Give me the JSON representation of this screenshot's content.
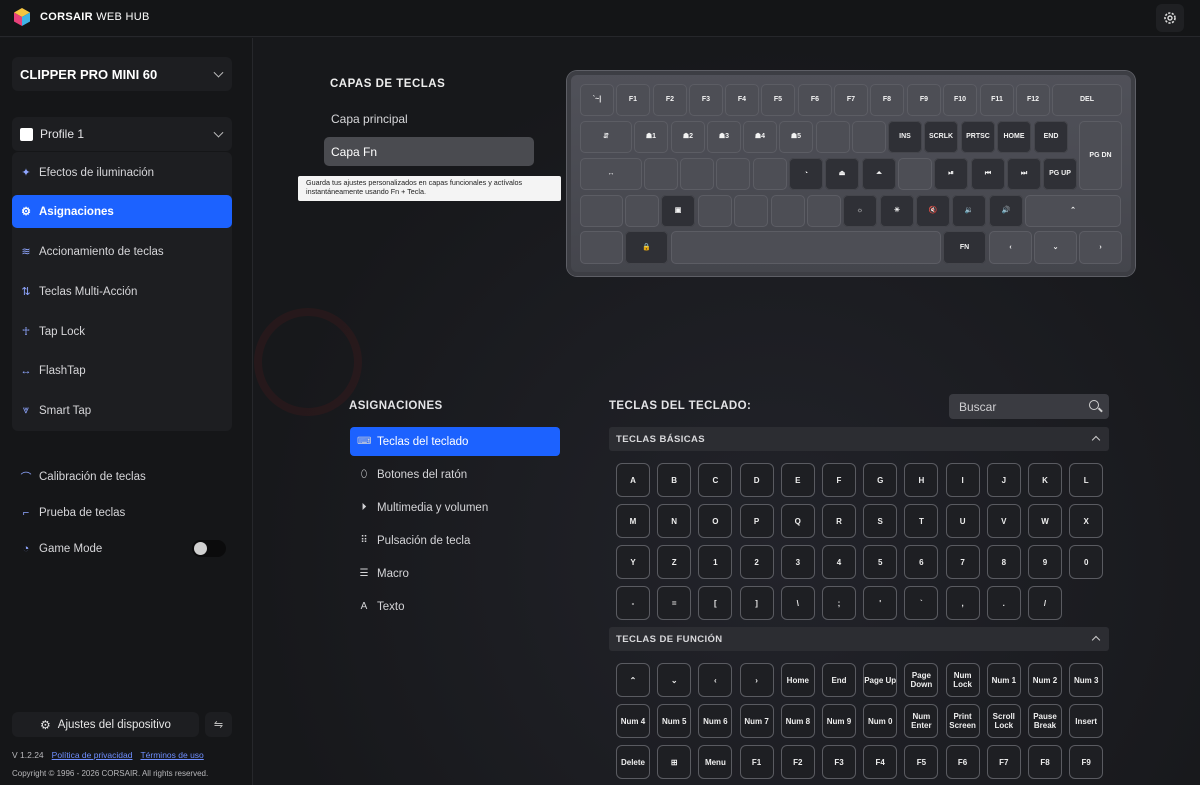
{
  "app": {
    "brand_bold": "CORSAIR",
    "brand_light": "WEB HUB"
  },
  "sidebar": {
    "device": "CLIPPER PRO MINI 60",
    "profile": "Profile 1",
    "nav": [
      {
        "label": "Efectos de iluminación",
        "icon": "sparkle-icon",
        "glyph": "✦"
      },
      {
        "label": "Asignaciones",
        "icon": "assign-icon",
        "glyph": "⚙"
      },
      {
        "label": "Accionamiento de teclas",
        "icon": "layers-icon",
        "glyph": "≋"
      },
      {
        "label": "Teclas Multi-Acción",
        "icon": "updown-arrows-icon",
        "glyph": "⇅"
      },
      {
        "label": "Tap Lock",
        "icon": "person-icon",
        "glyph": "☥"
      },
      {
        "label": "FlashTap",
        "icon": "leftright-arrows-icon",
        "glyph": "↔"
      },
      {
        "label": "Smart Tap",
        "icon": "chevrons-down-icon",
        "glyph": "⩔"
      }
    ],
    "tools": [
      {
        "label": "Calibración de teclas",
        "icon": "calibration-icon",
        "glyph": "⌒"
      },
      {
        "label": "Prueba de teclas",
        "icon": "test-icon",
        "glyph": "⌐"
      },
      {
        "label": "Game Mode",
        "icon": "gauge-icon",
        "glyph": "◔"
      }
    ],
    "game_mode_on": false,
    "settings_label": "Ajustes del dispositivo",
    "version": "V 1.2.24",
    "privacy": "Política de privacidad",
    "terms": "Términos de uso",
    "copyright": "Copyright © 1996 - 2026 CORSAIR. All rights reserved."
  },
  "layers": {
    "title": "CAPAS DE TECLAS",
    "items": [
      "Capa principal",
      "Capa Fn"
    ],
    "active": "Capa Fn",
    "tooltip": "Guarda tus ajustes personalizados en capas funcionales y actívalos instantáneamente usando Fn + Tecla."
  },
  "keyboard": {
    "row1": [
      "`~|",
      "F1",
      "F2",
      "F3",
      "F4",
      "F5",
      "F6",
      "F7",
      "F8",
      "F9",
      "F10",
      "F11",
      "F12",
      "DEL"
    ],
    "row2": [
      "⇵",
      "☗1",
      "☗2",
      "☗3",
      "☗4",
      "☗5",
      "",
      "",
      "INS",
      "SCRLK",
      "PRTSC",
      "HOME",
      "END",
      "PG DN"
    ],
    "row3": [
      "↔",
      "",
      "",
      "",
      "",
      "◔",
      "⏏",
      "⏶",
      "",
      "⏯",
      "⏮",
      "⏭",
      "PG UP"
    ],
    "row4": [
      "",
      "",
      "▣",
      "",
      "",
      "",
      "",
      "☼",
      "☀",
      "🔇",
      "🔉",
      "🔊",
      "⌃"
    ],
    "row5": [
      "",
      "🔒",
      "",
      "FN",
      "‹",
      "⌄",
      "›"
    ]
  },
  "assign": {
    "title": "ASIGNACIONES",
    "cats": [
      {
        "label": "Teclas del teclado",
        "glyph": "⌨",
        "icon": "keyboard-icon"
      },
      {
        "label": "Botones del ratón",
        "glyph": "⬯",
        "icon": "mouse-icon"
      },
      {
        "label": "Multimedia y volumen",
        "glyph": "⏵",
        "icon": "media-icon"
      },
      {
        "label": "Pulsación de tecla",
        "glyph": "⠿",
        "icon": "keypress-icon"
      },
      {
        "label": "Macro",
        "glyph": "☰",
        "icon": "macro-icon"
      },
      {
        "label": "Texto",
        "glyph": "A",
        "icon": "text-icon"
      }
    ]
  },
  "keys_panel": {
    "title": "TECLAS DEL TECLADO:",
    "search_placeholder": "Buscar",
    "basic_title": "TECLAS BÁSICAS",
    "basic": [
      [
        "A",
        "B",
        "C",
        "D",
        "E",
        "F",
        "G",
        "H",
        "I",
        "J",
        "K",
        "L"
      ],
      [
        "M",
        "N",
        "O",
        "P",
        "Q",
        "R",
        "S",
        "T",
        "U",
        "V",
        "W",
        "X"
      ],
      [
        "Y",
        "Z",
        "1",
        "2",
        "3",
        "4",
        "5",
        "6",
        "7",
        "8",
        "9",
        "0"
      ],
      [
        "-",
        "=",
        "[",
        "]",
        "\\",
        ";",
        "'",
        "`",
        ",",
        ".",
        "/"
      ]
    ],
    "func_title": "TECLAS DE FUNCIÓN",
    "func": [
      [
        "⌃",
        "⌄",
        "‹",
        "›",
        "Home",
        "End",
        "Page Up",
        "Page Down",
        "Num Lock",
        "Num 1",
        "Num 2",
        "Num 3"
      ],
      [
        "Num 4",
        "Num 5",
        "Num 6",
        "Num 7",
        "Num 8",
        "Num 9",
        "Num 0",
        "Num Enter",
        "Print Screen",
        "Scroll Lock",
        "Pause Break",
        "Insert"
      ],
      [
        "Delete",
        "⊞",
        "Menu",
        "F1",
        "F2",
        "F3",
        "F4",
        "F5",
        "F6",
        "F7",
        "F8",
        "F9"
      ]
    ]
  }
}
